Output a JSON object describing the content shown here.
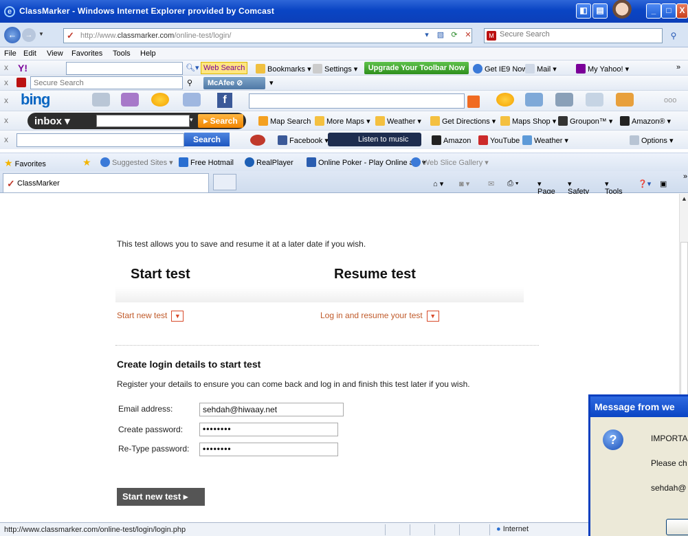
{
  "window": {
    "title": "ClassMarker - Windows Internet Explorer provided by Comcast"
  },
  "address": {
    "url_prefix": "http://www.",
    "url_domain": "classmarker.com",
    "url_path": "/online-test/login/",
    "search_placeholder": "Secure Search"
  },
  "menu": [
    "File",
    "Edit",
    "View",
    "Favorites",
    "Tools",
    "Help"
  ],
  "yahoo_toolbar": {
    "web_search": "Web Search",
    "bookmarks": "Bookmarks",
    "settings": "Settings",
    "upgrade": "Upgrade Your Toolbar Now",
    "ie9": "Get IE9 Now!",
    "mail": "Mail",
    "my_yahoo": "My Yahoo!"
  },
  "mcafee_toolbar": {
    "search_placeholder": "Secure Search",
    "brand": "McAfee"
  },
  "inbox_toolbar": {
    "brand": "inbox",
    "search": "Search",
    "map_search": "Map Search",
    "more_maps": "More Maps",
    "weather": "Weather",
    "directions": "Get Directions",
    "maps_shop": "Maps Shop",
    "groupon": "Groupon™",
    "amazon": "Amazon®"
  },
  "ask_toolbar": {
    "search": "Search",
    "facebook": "Facebook",
    "listen": "Listen to music",
    "amazon": "Amazon",
    "youtube": "YouTube",
    "weather": "Weather",
    "options": "Options"
  },
  "favorites_bar": {
    "favorites": "Favorites",
    "suggested": "Suggested Sites",
    "hotmail": "Free Hotmail",
    "realplayer": "RealPlayer",
    "poker": "Online Poker - Play Online a...",
    "webslice": "Web Slice Gallery"
  },
  "tab": {
    "label": "ClassMarker"
  },
  "command_bar": {
    "page": "Page",
    "safety": "Safety",
    "tools": "Tools"
  },
  "content": {
    "intro": "This test allows you to save and resume it at a later date if you wish.",
    "start_heading": "Start test",
    "resume_heading": "Resume test",
    "start_link": "Start new test",
    "resume_link": "Log in and resume your test",
    "create_heading": "Create login details to start test",
    "register_text": "Register your details to ensure you can come back and log in and finish this test later if you wish.",
    "email_label": "Email address:",
    "email_value": "sehdah@hiwaay.net",
    "password_label": "Create password:",
    "password_value": "••••••••",
    "retype_label": "Re-Type password:",
    "retype_value": "••••••••",
    "submit": "Start new test"
  },
  "dialog": {
    "title": "Message from we",
    "line1": "IMPORTA",
    "line2": "Please ch",
    "line3": "sehdah@"
  },
  "status": {
    "url": "http://www.classmarker.com/online-test/login/login.php",
    "zone": "Internet"
  }
}
